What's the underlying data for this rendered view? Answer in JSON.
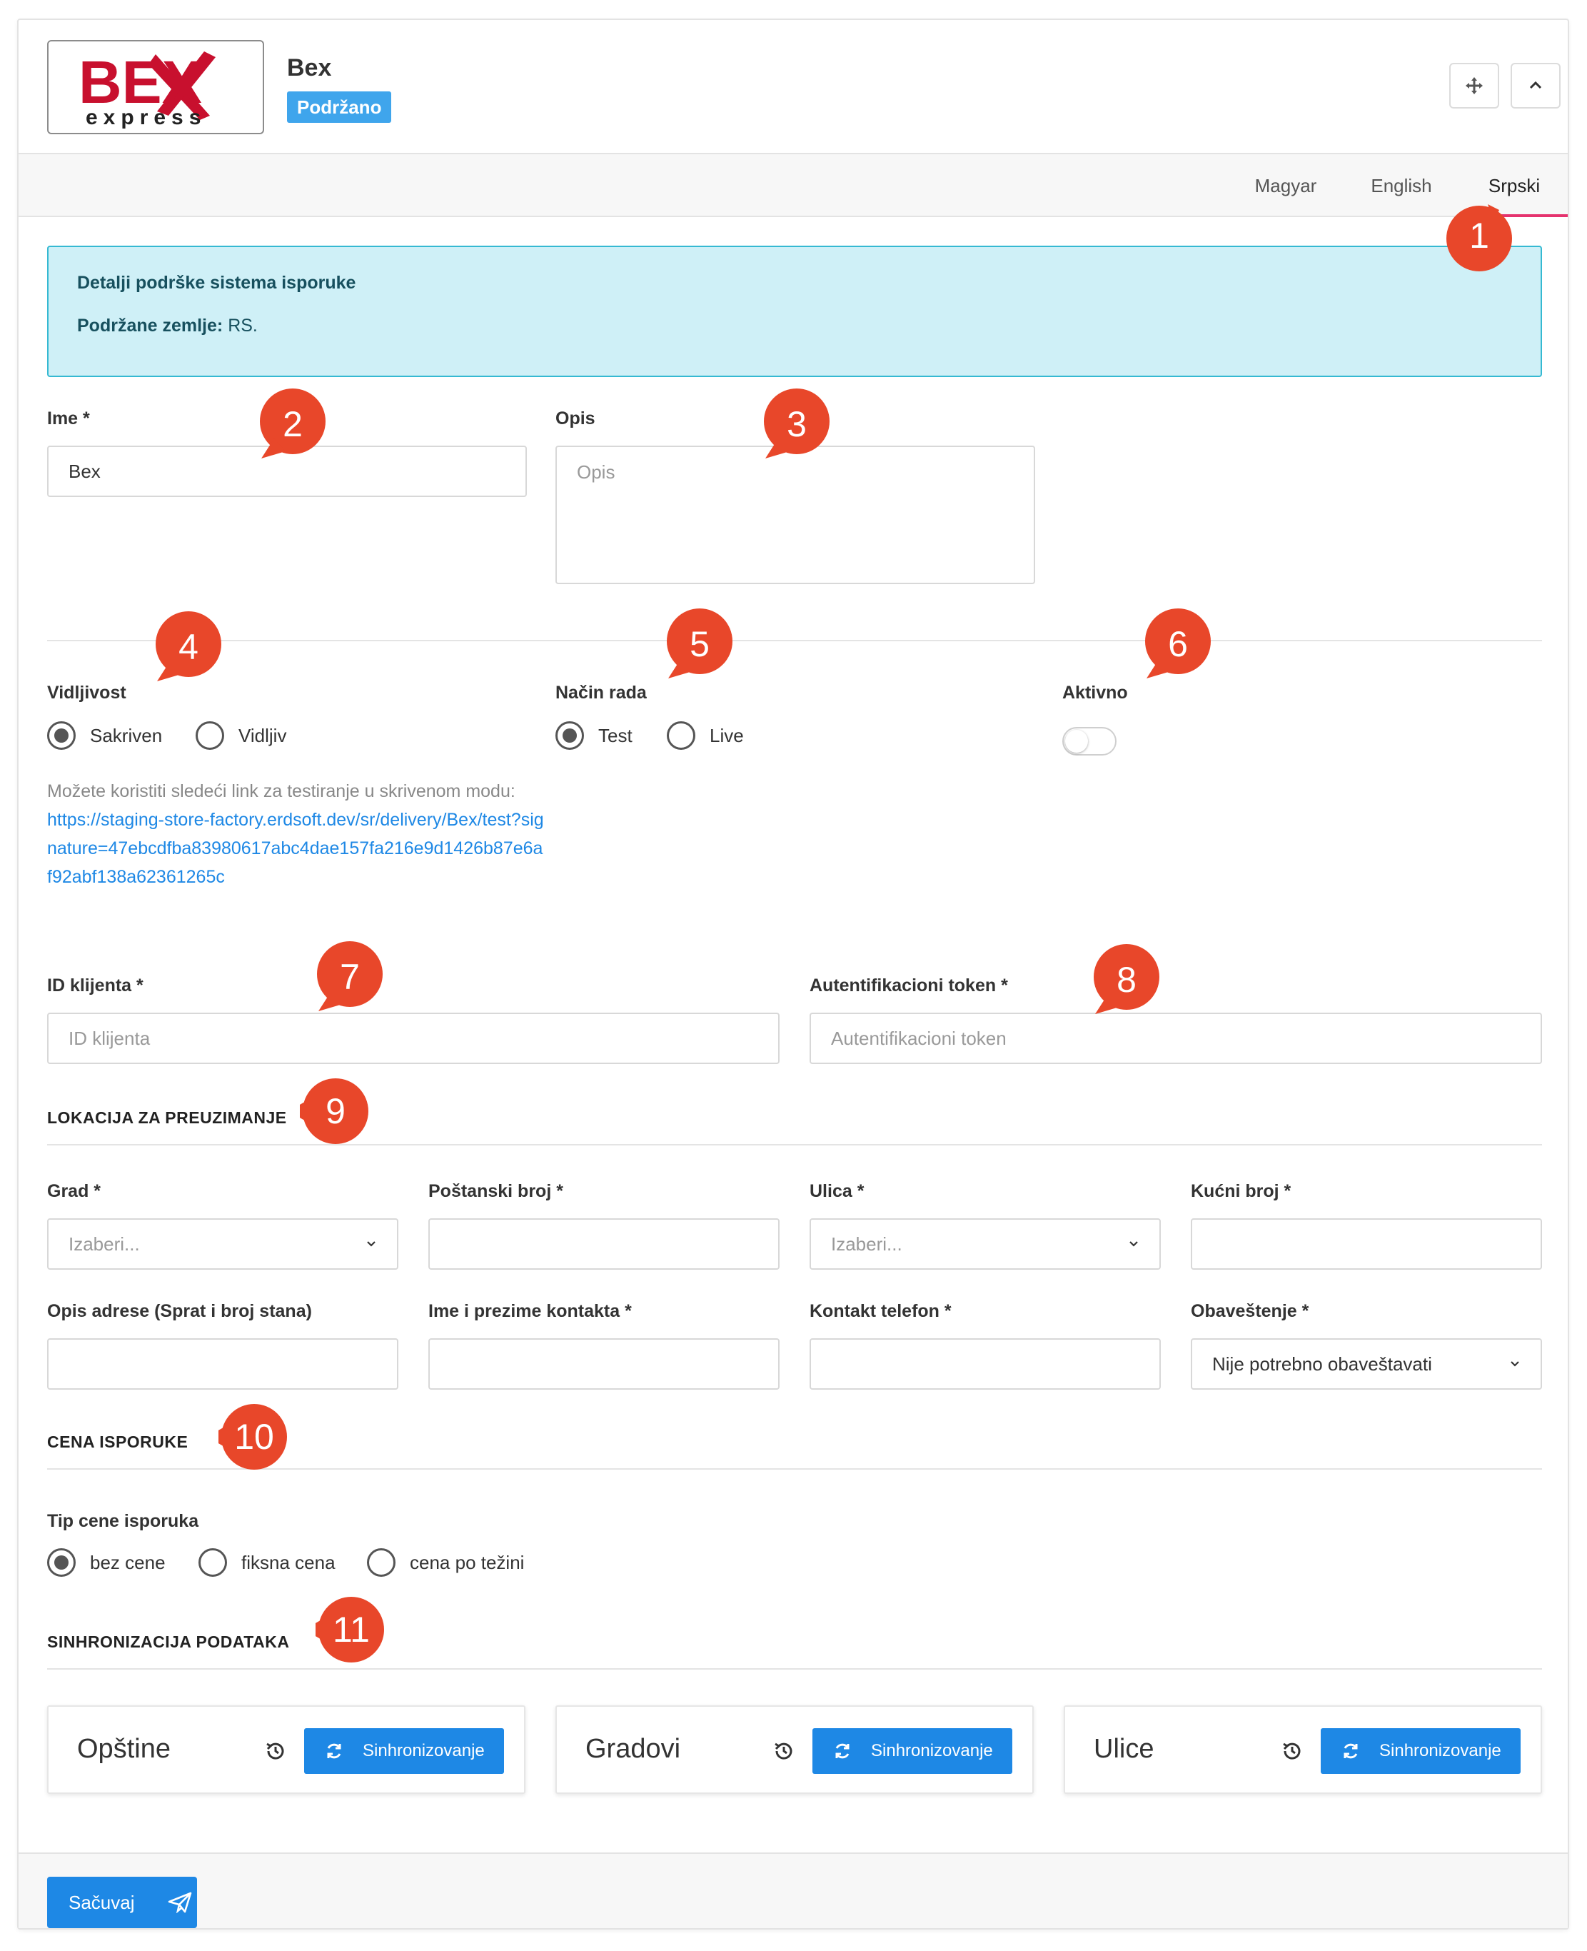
{
  "header": {
    "logo_text_main": "BEX",
    "logo_text_sub": "express",
    "title": "Bex",
    "badge": "Podržano"
  },
  "tabs": [
    {
      "label": "Magyar",
      "active": false
    },
    {
      "label": "English",
      "active": false
    },
    {
      "label": "Srpski",
      "active": true
    }
  ],
  "info": {
    "title": "Detalji podrške sistema isporuke",
    "countries_label": "Podržane zemlje:",
    "countries_value": "RS."
  },
  "fields": {
    "name_label": "Ime *",
    "name_value": "Bex",
    "description_label": "Opis",
    "description_placeholder": "Opis",
    "visibility_label": "Vidljivost",
    "visibility_options": [
      "Sakriven",
      "Vidljiv"
    ],
    "visibility_selected": "Sakriven",
    "mode_label": "Način rada",
    "mode_options": [
      "Test",
      "Live"
    ],
    "mode_selected": "Test",
    "active_label": "Aktivno",
    "active_on": false,
    "help_text": "Možete koristiti sledeći link za testiranje u skrivenom modu:",
    "help_link": "https://staging-store-factory.erdsoft.dev/sr/delivery/Bex/test?signature=47ebcdfba83980617abc4dae157fa216e9d1426b87e6af92abf138a62361265c",
    "client_id_label": "ID klijenta *",
    "client_id_placeholder": "ID klijenta",
    "auth_token_label": "Autentifikacioni token *",
    "auth_token_placeholder": "Autentifikacioni token"
  },
  "pickup": {
    "section_title": "LOKACIJA ZA PREUZIMANJE",
    "city_label": "Grad *",
    "city_placeholder": "Izaberi...",
    "postal_label": "Poštanski broj *",
    "street_label": "Ulica *",
    "street_placeholder": "Izaberi...",
    "house_label": "Kućni broj *",
    "address_desc_label": "Opis adrese (Sprat i broj stana)",
    "contact_name_label": "Ime i prezime kontakta *",
    "contact_phone_label": "Kontakt telefon *",
    "notification_label": "Obaveštenje *",
    "notification_value": "Nije potrebno obaveštavati"
  },
  "pricing": {
    "section_title": "CENA ISPORUKE",
    "type_label": "Tip cene isporuka",
    "options": [
      "bez cene",
      "fiksna cena",
      "cena po težini"
    ],
    "selected": "bez cene"
  },
  "sync": {
    "section_title": "SINHRONIZACIJA PODATAKA",
    "cards": [
      {
        "name": "Opštine",
        "button": "Sinhronizovanje"
      },
      {
        "name": "Gradovi",
        "button": "Sinhronizovanje"
      },
      {
        "name": "Ulice",
        "button": "Sinhronizovanje"
      }
    ]
  },
  "footer": {
    "save_label": "Sačuvaj"
  },
  "markers": [
    "1",
    "2",
    "3",
    "4",
    "5",
    "6",
    "7",
    "8",
    "9",
    "10",
    "11"
  ],
  "colors": {
    "accent": "#1e88e5",
    "badge": "#3fa5ec",
    "tab_active": "#e5336e",
    "info_bg": "#cff0f7",
    "info_border": "#35b9d2",
    "marker": "#e8472a"
  }
}
